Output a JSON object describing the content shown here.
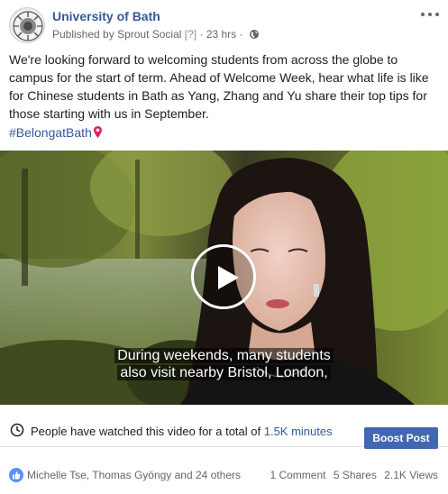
{
  "post": {
    "page_name": "University of Bath",
    "published_prefix": "Published by",
    "publisher": "Sprout Social",
    "help_marker": "[?]",
    "separator": "·",
    "time": "23 hrs",
    "separator2": "·",
    "body": "We're looking forward to welcoming students from across the globe to campus for the start of term. Ahead of Welcome Week, hear what life is like for Chinese students in Bath as Yang, Zhang and Yu share their top tips for those starting with us in September.",
    "hashtag": "#BelongatBath"
  },
  "video": {
    "subtitle_line1": "During weekends, many students",
    "subtitle_line2": "also visit nearby Bristol, London,"
  },
  "insights": {
    "text_before": "People have watched this video for a total of",
    "minutes": "1.5K minutes",
    "boost_label": "Boost Post"
  },
  "engagement": {
    "likers": "Michelle Tse, Thomas Gyöngy and 24 others",
    "comments": "1 Comment",
    "shares": "5 Shares",
    "views": "2.1K Views"
  },
  "colors": {
    "link_blue": "#365899",
    "boost_blue": "#4267b2",
    "like_blue": "#5890ff",
    "meta_gray": "#606770"
  },
  "icons": [
    "university-crest-avatar",
    "more-options-icon",
    "globe-icon",
    "pin-icon",
    "play-icon",
    "clock-icon",
    "like-icon"
  ]
}
